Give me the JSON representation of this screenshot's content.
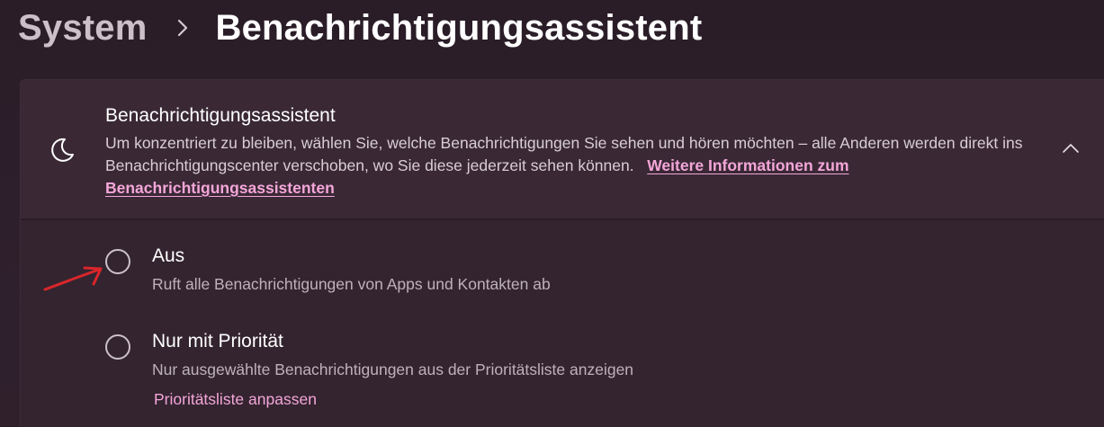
{
  "breadcrumb": {
    "parent": "System",
    "current": "Benachrichtigungsassistent"
  },
  "card": {
    "title": "Benachrichtigungsassistent",
    "description": "Um konzentriert zu bleiben, wählen Sie, welche Benachrichtigungen Sie sehen und hören möchten – alle Anderen werden direkt ins Benachrichtigungscenter verschoben, wo Sie diese jederzeit sehen können.",
    "link": "Weitere Informationen zum Benachrichtigungsassistenten",
    "icon": "moon-icon",
    "expander_icon": "chevron-up-icon"
  },
  "options": [
    {
      "label": "Aus",
      "description": "Ruft alle Benachrichtigungen von Apps und Kontakten ab",
      "selected": false
    },
    {
      "label": "Nur mit Priorität",
      "description": "Nur ausgewählte Benachrichtigungen aus der Prioritätsliste anzeigen",
      "link": "Prioritätsliste anpassen",
      "selected": false
    }
  ],
  "colors": {
    "accent_link": "#f4a6d9",
    "annotation": "#d9262b",
    "background": "#2d1f2b"
  }
}
